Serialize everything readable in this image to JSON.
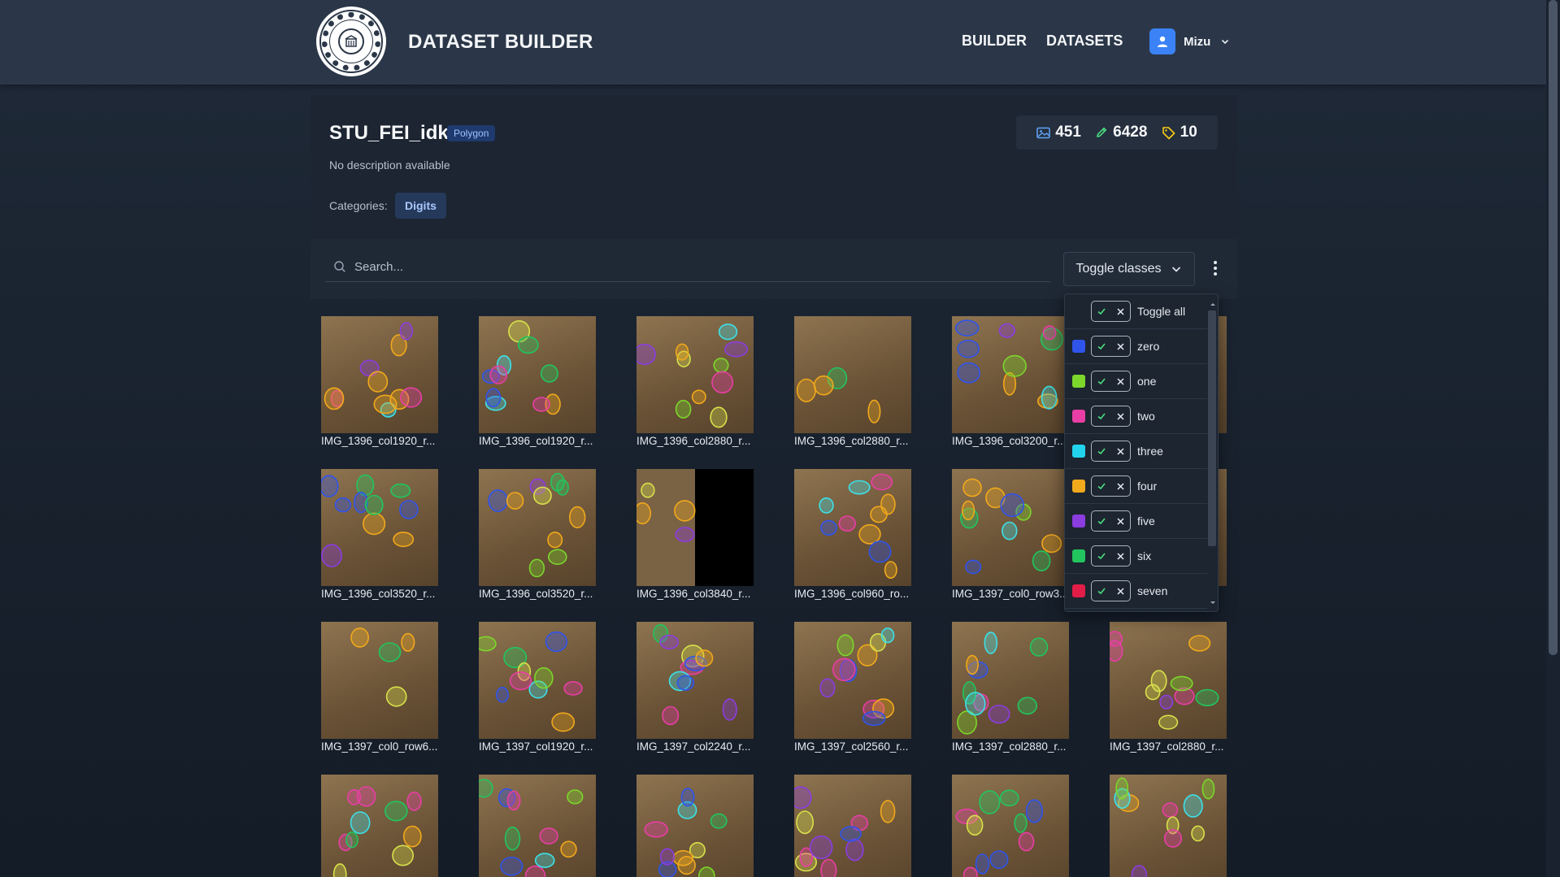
{
  "app": {
    "title": "DATASET BUILDER"
  },
  "nav": {
    "builder": "BUILDER",
    "datasets": "DATASETS"
  },
  "user": {
    "name": "Mizu"
  },
  "dataset": {
    "name": "STU_FEI_idk",
    "type": "Polygon",
    "description": "No description available",
    "categories_label": "Categories:",
    "categories": [
      "Digits"
    ],
    "stats": {
      "images": "451",
      "annotations": "6428",
      "classes": "10"
    }
  },
  "search": {
    "placeholder": "Search..."
  },
  "toggle_classes": {
    "label": "Toggle classes"
  },
  "class_dropdown": {
    "toggle_all": "Toggle all",
    "classes": [
      {
        "name": "zero",
        "color": "#2f54eb"
      },
      {
        "name": "one",
        "color": "#7cd62b"
      },
      {
        "name": "two",
        "color": "#e83ea5"
      },
      {
        "name": "three",
        "color": "#22d3ee"
      },
      {
        "name": "four",
        "color": "#f0a81c"
      },
      {
        "name": "five",
        "color": "#8b3ddf"
      },
      {
        "name": "six",
        "color": "#22c55e"
      },
      {
        "name": "seven",
        "color": "#e11d48"
      }
    ]
  },
  "images": [
    "IMG_1396_col1920_r...",
    "IMG_1396_col1920_r...",
    "IMG_1396_col2880_r...",
    "IMG_1396_col2880_r...",
    "IMG_1396_col3200_r...",
    "",
    "IMG_1396_col3520_r...",
    "IMG_1396_col3520_r...",
    "IMG_1396_col3840_r...",
    "IMG_1396_col960_ro...",
    "IMG_1397_col0_row3...",
    "",
    "IMG_1397_col0_row6...",
    "IMG_1397_col1920_r...",
    "IMG_1397_col2240_r...",
    "IMG_1397_col2560_r...",
    "IMG_1397_col2880_r...",
    "IMG_1397_col2880_r...",
    "",
    "",
    "",
    "",
    "",
    ""
  ]
}
